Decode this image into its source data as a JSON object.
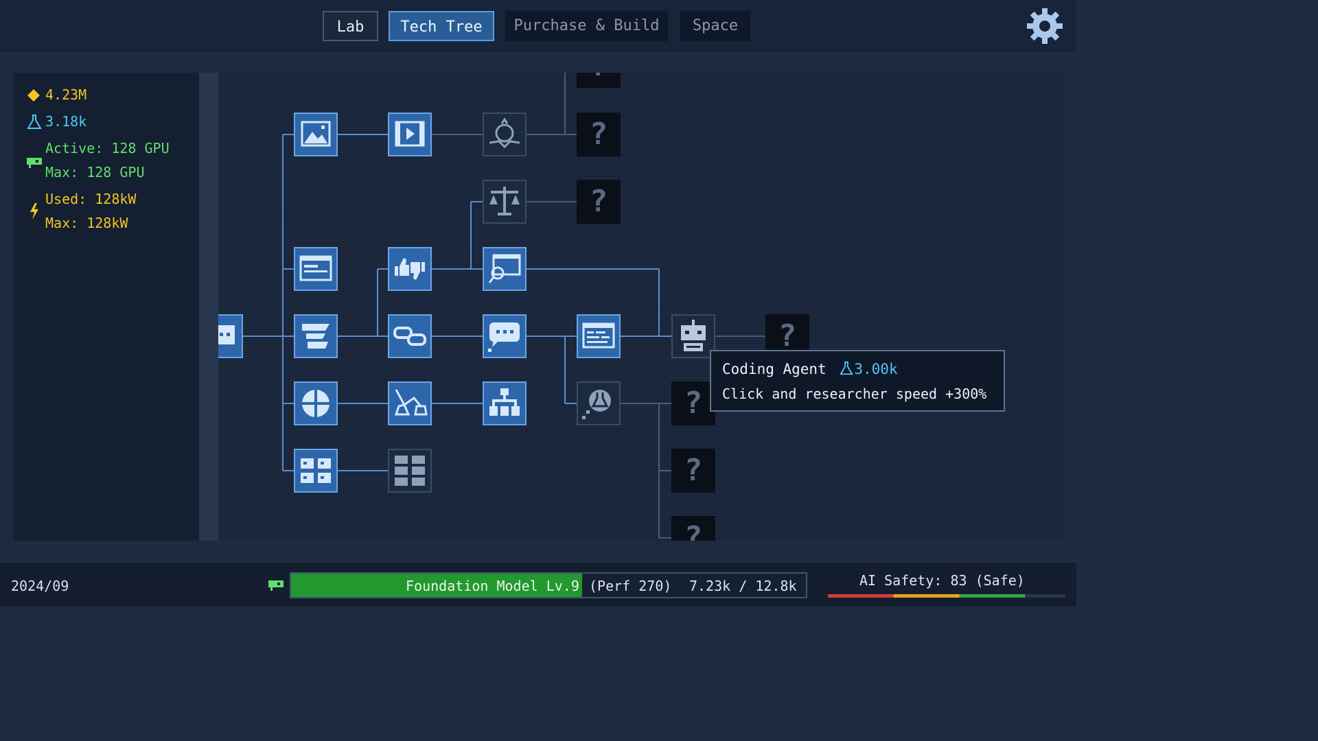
{
  "tabs": [
    {
      "label": "Lab",
      "state": "normal"
    },
    {
      "label": "Tech Tree",
      "state": "active"
    },
    {
      "label": "Purchase & Build",
      "state": "dim"
    },
    {
      "label": "Space",
      "state": "dim"
    }
  ],
  "settings_icon": "gear-icon",
  "stats": {
    "money": "4.23M",
    "research": "3.18k",
    "gpu_active": "Active: 128 GPU",
    "gpu_max": "Max: 128 GPU",
    "power_used": "Used: 128kW",
    "power_max": "Max: 128kW"
  },
  "colors": {
    "money": "#f3c623",
    "research": "#4fc9f2",
    "gpu": "#5fe06a",
    "power": "#f3c623",
    "unlocked": "#2d66ab",
    "safety_bar": [
      "#d43b3b",
      "#e6a51d",
      "#35a84a"
    ]
  },
  "tech_nodes": [
    {
      "id": "chat-start",
      "icon": "chat-bubble-icon",
      "state": "unlocked"
    },
    {
      "id": "image-gen",
      "icon": "image-icon",
      "state": "unlocked"
    },
    {
      "id": "video-gen",
      "icon": "video-icon",
      "state": "unlocked"
    },
    {
      "id": "robot-arm",
      "icon": "robot-arm-icon",
      "state": "available"
    },
    {
      "id": "unknown-top",
      "icon": "question-icon",
      "state": "unknown"
    },
    {
      "id": "unknown-1",
      "icon": "question-icon",
      "state": "unknown"
    },
    {
      "id": "ethics",
      "icon": "scales-icon",
      "state": "available"
    },
    {
      "id": "unknown-2",
      "icon": "question-icon",
      "state": "unknown"
    },
    {
      "id": "web-ui",
      "icon": "browser-window-icon",
      "state": "unlocked"
    },
    {
      "id": "rlhf",
      "icon": "thumbs-up-down-icon",
      "state": "unlocked"
    },
    {
      "id": "web-search",
      "icon": "search-window-icon",
      "state": "unlocked"
    },
    {
      "id": "text-align",
      "icon": "text-align-icon",
      "state": "unlocked"
    },
    {
      "id": "tool-use",
      "icon": "chain-link-icon",
      "state": "unlocked"
    },
    {
      "id": "chat-app",
      "icon": "chat-bubble-icon",
      "state": "unlocked"
    },
    {
      "id": "code-editor",
      "icon": "code-window-icon",
      "state": "unlocked"
    },
    {
      "id": "coding-agent",
      "icon": "robot-agent-icon",
      "state": "available"
    },
    {
      "id": "unknown-3",
      "icon": "question-icon",
      "state": "unknown"
    },
    {
      "id": "multilingual",
      "icon": "globe-icon",
      "state": "unlocked"
    },
    {
      "id": "distillation",
      "icon": "flask-branch-icon",
      "state": "unlocked"
    },
    {
      "id": "moe",
      "icon": "hierarchy-icon",
      "state": "unlocked"
    },
    {
      "id": "science-chat",
      "icon": "flask-bubble-icon",
      "state": "available"
    },
    {
      "id": "unknown-4",
      "icon": "question-icon",
      "state": "unknown"
    },
    {
      "id": "cluster",
      "icon": "server-grid-icon",
      "state": "unlocked"
    },
    {
      "id": "datacenter",
      "icon": "server-grid-icon",
      "state": "available"
    },
    {
      "id": "unknown-5",
      "icon": "question-icon",
      "state": "unknown"
    },
    {
      "id": "unknown-6",
      "icon": "question-icon",
      "state": "unknown"
    }
  ],
  "tooltip": {
    "name": "Coding Agent",
    "cost": "3.00k",
    "description": "Click and researcher speed +300%"
  },
  "bottom": {
    "date": "2024/09",
    "model_name": "Foundation Model Lv.9",
    "model_perf": "(Perf 270)",
    "model_progress": "7.23k / 12.8k",
    "progress_fraction": 0.565,
    "safety_text": "AI Safety: 83 (Safe)",
    "safety_fraction": 0.83
  }
}
